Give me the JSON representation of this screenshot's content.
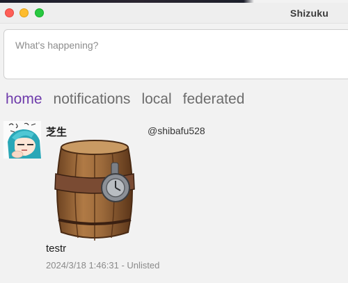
{
  "window": {
    "title": "Shizuku",
    "controls": [
      "close",
      "minimize",
      "maximize"
    ]
  },
  "compose": {
    "placeholder": "What's happening?",
    "value": ""
  },
  "tabs": [
    {
      "label": "home",
      "active": true
    },
    {
      "label": "notifications",
      "active": false
    },
    {
      "label": "local",
      "active": false
    },
    {
      "label": "federated",
      "active": false
    }
  ],
  "post": {
    "display_name": "芝生",
    "acct": "@shibafu528",
    "text": "testr",
    "timestamp": "2024/3/18 1:46:31",
    "separator": " - ",
    "visibility": "Unlisted"
  },
  "icons": {
    "avatar": "anime-avatar",
    "attachment": "barrel-image"
  },
  "colors": {
    "active_tab": "#6e3bab",
    "inactive_tab": "#6c6c6c",
    "meta": "#8a8a8a",
    "close": "#fe5f57",
    "minimize": "#febc2e",
    "maximize": "#28c840"
  }
}
